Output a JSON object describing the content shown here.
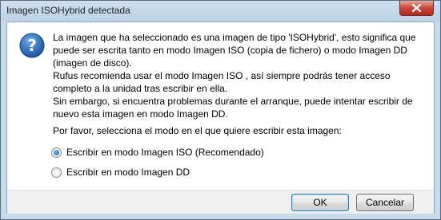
{
  "window": {
    "title": "Imagen ISOHybrid detectada"
  },
  "dialog": {
    "icon": "question-icon",
    "message": [
      "La imagen que ha seleccionado es una imagen de tipo 'ISOHybrid', esto significa que puede ser escrita tanto en modo Imagen ISO (copia de fichero) o modo Imagen DD (imagen de disco).",
      "Rufus recomienda usar el modo Imagen ISO , así siempre podrás tener acceso completo a la unidad tras escribir en ella.",
      "Sin embargo, si encuentra problemas durante el arranque, puede intentar escribir de nuevo esta imagen en modo Imagen DD."
    ],
    "prompt": "Por favor, selecciona el modo en el que quiere escribir esta imagen:",
    "options": [
      {
        "label": "Escribir en modo Imagen ISO (Recomendado)",
        "selected": true
      },
      {
        "label": "Escribir en modo Imagen DD",
        "selected": false
      }
    ]
  },
  "buttons": {
    "ok": "OK",
    "cancel": "Cancelar"
  },
  "colors": {
    "accent": "#3c7fb1",
    "frame": "#c8dbe9",
    "close": "#c9463a"
  }
}
